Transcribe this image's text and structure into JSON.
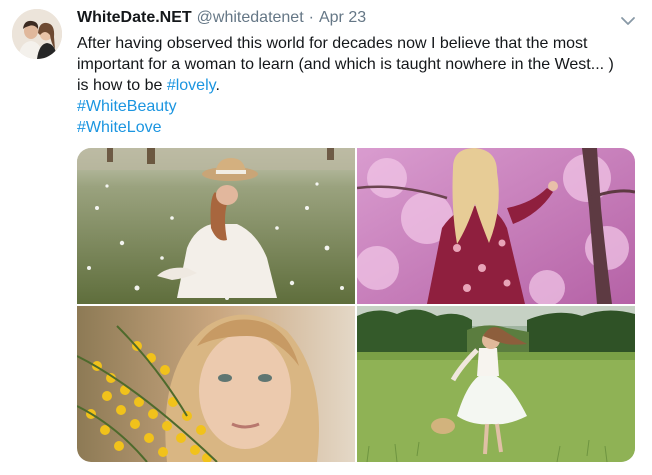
{
  "tweet": {
    "display_name": "WhiteDate.NET",
    "handle": "@whitedatenet",
    "separator": "·",
    "date": "Apr 23",
    "text_lines": [
      "After having observed this world for decades now I believe that the most",
      "important for a woman to learn (and which is taught nowhere in the West... )",
      "is how to be "
    ],
    "inline_hashtag": "#lovely",
    "inline_suffix": ".",
    "hashtags": [
      "#WhiteBeauty",
      "#WhiteLove"
    ]
  },
  "icons": {
    "more_menu": "chevron-down-icon"
  },
  "colors": {
    "link": "#1b95e0",
    "muted": "#657786",
    "text": "#14171a"
  }
}
